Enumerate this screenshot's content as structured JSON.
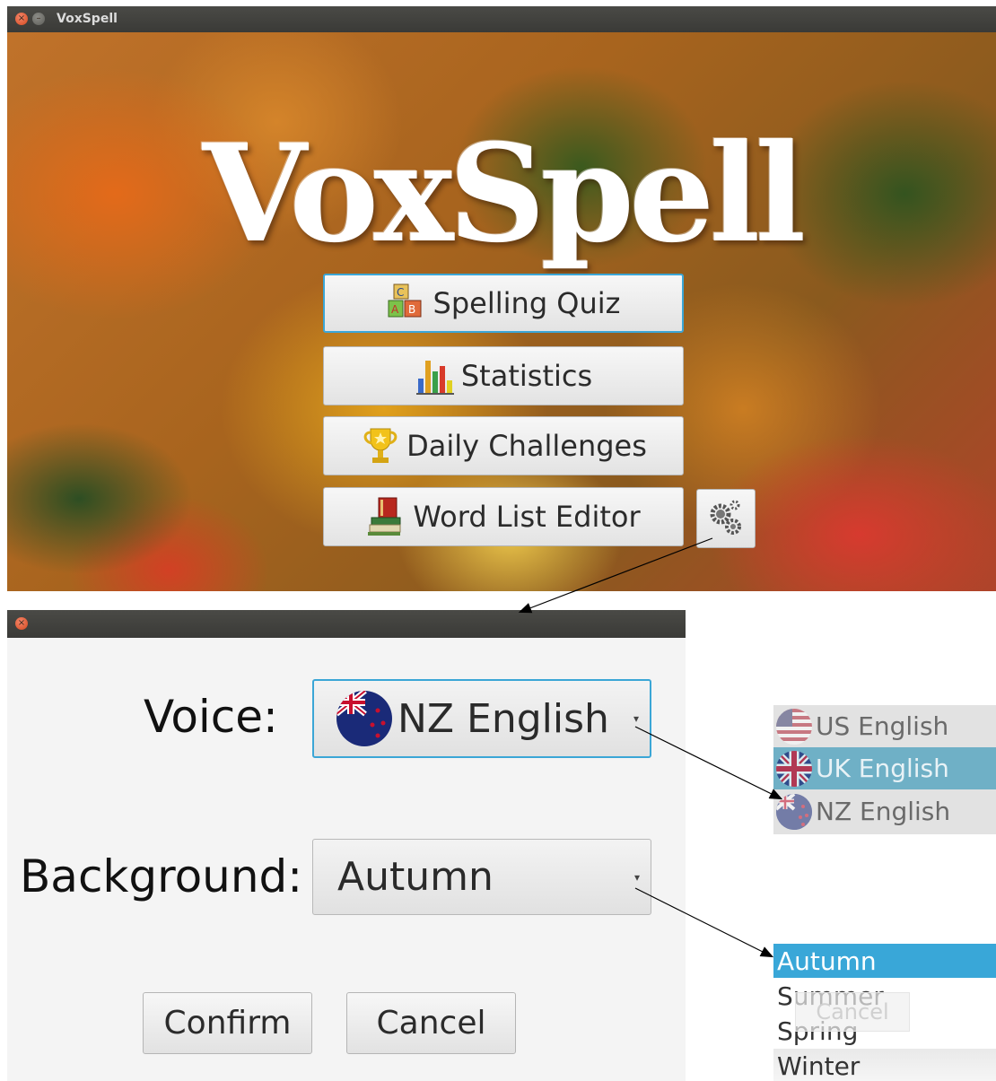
{
  "window": {
    "title": "VoxSpell"
  },
  "app": {
    "title": "VoxSpell"
  },
  "menu": {
    "items": [
      {
        "label": "Spelling Quiz",
        "icon": "abc-blocks-icon"
      },
      {
        "label": "Statistics",
        "icon": "bar-chart-icon"
      },
      {
        "label": "Daily Challenges",
        "icon": "trophy-icon"
      },
      {
        "label": "Word List Editor",
        "icon": "books-icon"
      }
    ],
    "settings_icon": "gears-icon"
  },
  "settings_dialog": {
    "voice_label": "Voice:",
    "voice_value": "NZ English",
    "background_label": "Background:",
    "background_value": "Autumn",
    "confirm_label": "Confirm",
    "cancel_label": "Cancel"
  },
  "voice_options": [
    {
      "label": "US English",
      "flag": "us-flag-icon"
    },
    {
      "label": "UK English",
      "flag": "uk-flag-icon",
      "selected": true
    },
    {
      "label": "NZ English",
      "flag": "nz-flag-icon"
    }
  ],
  "background_options": [
    {
      "label": "Autumn",
      "selected": true
    },
    {
      "label": "Summer"
    },
    {
      "label": "Spring"
    },
    {
      "label": "Winter"
    }
  ],
  "ghost_button_label": "Cancel",
  "colors": {
    "focus_ring": "#3ba6d6",
    "selection": "#39a7d8",
    "titlebar": "#3c3c39"
  }
}
